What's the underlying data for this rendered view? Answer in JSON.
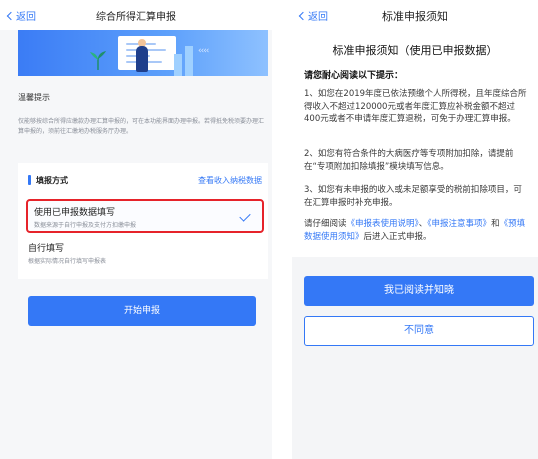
{
  "left": {
    "nav": {
      "back_label": "返回",
      "title": "综合所得汇算申报"
    },
    "notice": {
      "title": "温馨提示",
      "body": "仅能够按综合所得应缴款办理汇算申报的，可在本功能界面办理申报。若得抵免税须要办理汇算申报的，须前往汇缴地办税服务厅办理。"
    },
    "method": {
      "label": "填报方式",
      "link": "查看收入纳税数据",
      "option_prefilled": {
        "title": "使用已申报数据填写",
        "subtitle": "数据来源于自行申报及支付方扣缴申报"
      },
      "option_manual": {
        "title": "自行填写",
        "subtitle": "根据实际情况自行填写申报表"
      }
    },
    "start_button": "开始申报"
  },
  "right": {
    "nav": {
      "back_label": "返回",
      "title": "标准申报须知"
    },
    "heading": "标准申报须知（使用已申报数据）",
    "sub": "请您耐心阅读以下提示：",
    "p1": "1、如您在2019年度已依法预缴个人所得税，且年度综合所得收入不超过120000元或者年度汇算应补税金额不超过400元或者不申请年度汇算退税，可免于办理汇算申报。",
    "p2": "2、如您有符合条件的大病医疗等专项附加扣除，请提前在“专项附加扣除填报”模块填写信息。",
    "p3": "3、如您有未申报的收入或未足额享受的税前扣除项目，可在汇算申报时补充申报。",
    "p4": {
      "pre": "请仔细阅读",
      "link1": "《申报表使用说明》",
      "sep1": "、",
      "link2": "《申报注意事项》",
      "sep2": "和",
      "link3": "《预填数据使用须知》",
      "post": "后进入正式申报。"
    },
    "agree_button": "我已阅读并知晓",
    "disagree_button": "不同意"
  }
}
